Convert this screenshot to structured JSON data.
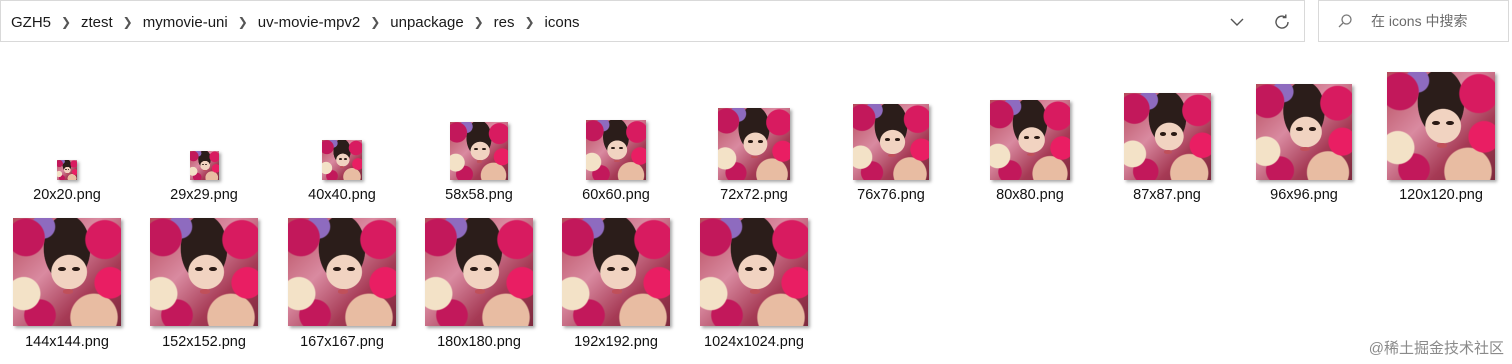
{
  "breadcrumb": [
    "GZH5",
    "ztest",
    "mymovie-uni",
    "uv-movie-mpv2",
    "unpackage",
    "res",
    "icons"
  ],
  "search": {
    "placeholder": "在 icons 中搜索"
  },
  "files": [
    {
      "name": "20x20.png"
    },
    {
      "name": "29x29.png"
    },
    {
      "name": "40x40.png"
    },
    {
      "name": "58x58.png"
    },
    {
      "name": "60x60.png"
    },
    {
      "name": "72x72.png"
    },
    {
      "name": "76x76.png"
    },
    {
      "name": "80x80.png"
    },
    {
      "name": "87x87.png"
    },
    {
      "name": "96x96.png"
    },
    {
      "name": "120x120.png"
    },
    {
      "name": "144x144.png"
    },
    {
      "name": "152x152.png"
    },
    {
      "name": "167x167.png"
    },
    {
      "name": "180x180.png"
    },
    {
      "name": "192x192.png"
    },
    {
      "name": "1024x1024.png"
    }
  ],
  "watermark": "@稀土掘金技术社区"
}
